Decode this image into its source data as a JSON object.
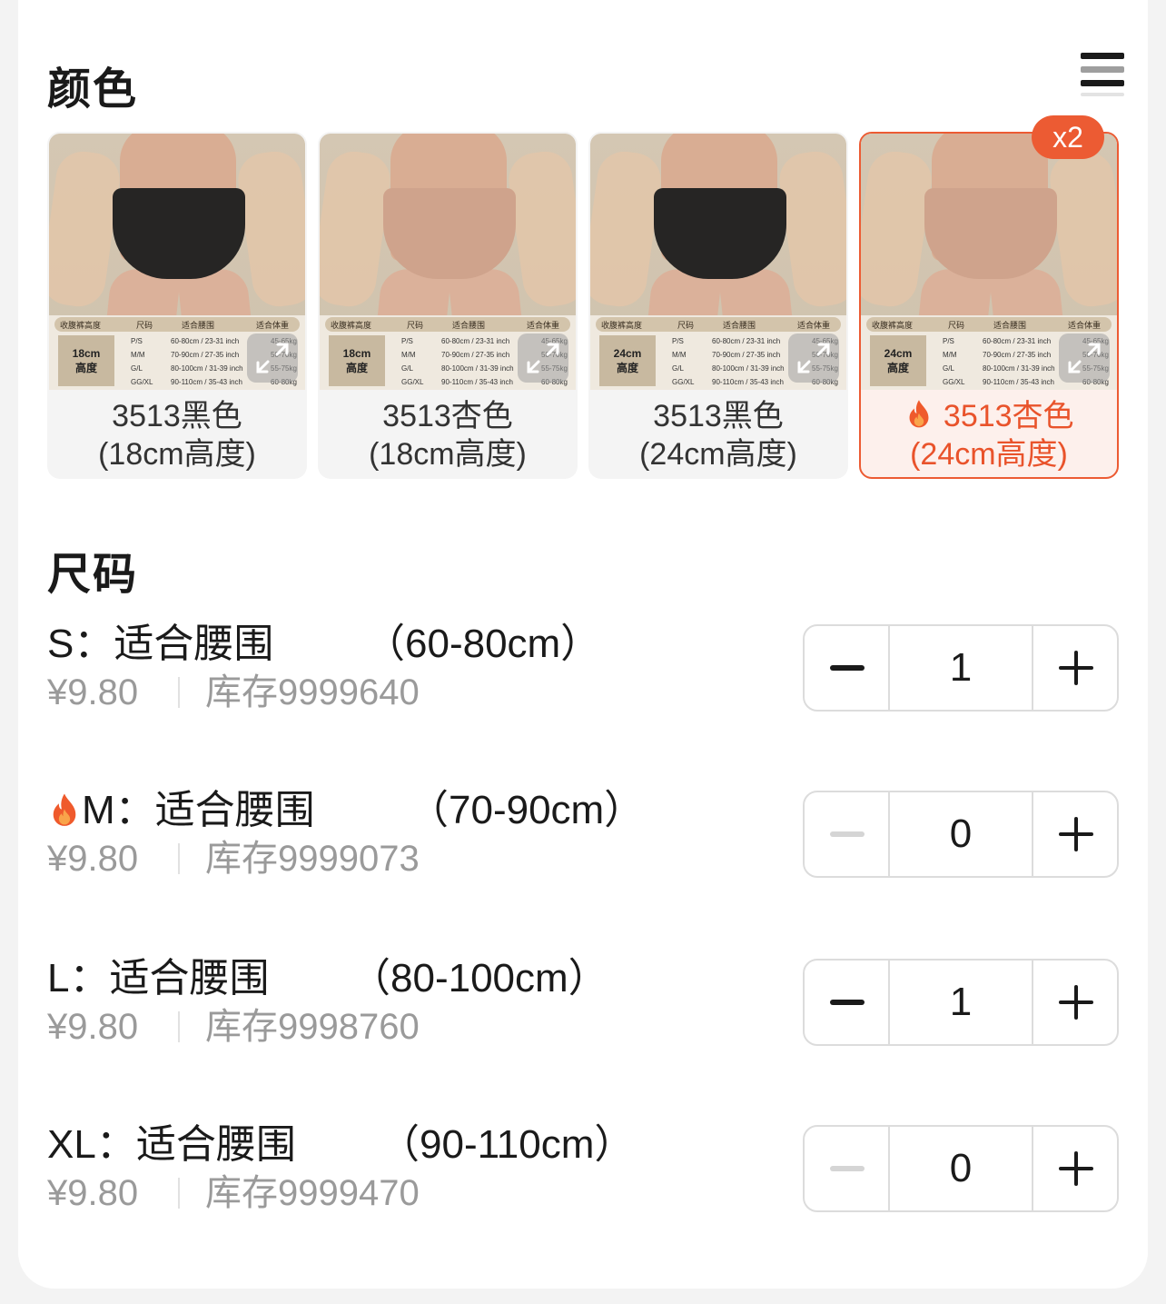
{
  "color_section": {
    "title": "颜色"
  },
  "size_section": {
    "title": "尺码"
  },
  "swatches": [
    {
      "label_line1": "3513黑色",
      "label_line2": "(18cm高度)",
      "garment_color": "#262524",
      "height_badge_line1": "18cm",
      "height_badge_line2": "高度",
      "selected": false,
      "hot": false
    },
    {
      "label_line1": "3513杏色",
      "label_line2": "(18cm高度)",
      "garment_color": "#cfa38c",
      "height_badge_line1": "18cm",
      "height_badge_line2": "高度",
      "selected": false,
      "hot": false
    },
    {
      "label_line1": "3513黑色",
      "label_line2": "(24cm高度)",
      "garment_color": "#262524",
      "height_badge_line1": "24cm",
      "height_badge_line2": "高度",
      "selected": false,
      "hot": false
    },
    {
      "label_line1": "3513杏色",
      "label_line2": "(24cm高度)",
      "garment_color": "#cfa38c",
      "height_badge_line1": "24cm",
      "height_badge_line2": "高度",
      "selected": true,
      "hot": true,
      "count_badge": "x2"
    }
  ],
  "size_table": {
    "headers": [
      "收腹裤高度",
      "尺码",
      "适合腰围",
      "适合体重"
    ],
    "rows": [
      {
        "size": "P/S",
        "waist": "60-80cm / 23-31 inch",
        "weight": "45-65kg"
      },
      {
        "size": "M/M",
        "waist": "70-90cm / 27-35 inch",
        "weight": "50-70kg"
      },
      {
        "size": "G/L",
        "waist": "80-100cm / 31-39 inch",
        "weight": "55-75kg"
      },
      {
        "size": "GG/XL",
        "waist": "90-110cm / 35-43 inch",
        "weight": "60-80kg"
      }
    ]
  },
  "sizes": [
    {
      "name": "S：适合腰围",
      "range": "（60-80cm）",
      "price": "¥9.80",
      "stock": "库存9999640",
      "qty": "1",
      "hot": false,
      "minus_enabled": true
    },
    {
      "name": "M：适合腰围",
      "range": "（70-90cm）",
      "price": "¥9.80",
      "stock": "库存9999073",
      "qty": "0",
      "hot": true,
      "minus_enabled": false
    },
    {
      "name": "L：适合腰围",
      "range": "（80-100cm）",
      "price": "¥9.80",
      "stock": "库存9998760",
      "qty": "1",
      "hot": false,
      "minus_enabled": true
    },
    {
      "name": "XL：适合腰围",
      "range": "（90-110cm）",
      "price": "¥9.80",
      "stock": "库存9999470",
      "qty": "0",
      "hot": false,
      "minus_enabled": false
    }
  ],
  "colors": {
    "accent": "#ec5b33",
    "accent_text": "#e9532b",
    "muted_text": "#9a9a9a",
    "border": "#dcdcdc"
  },
  "icons": {
    "list_toggle": "list-view-icon",
    "expand": "expand-icon",
    "hot": "fire-icon",
    "minus": "minus-icon",
    "plus": "plus-icon"
  }
}
